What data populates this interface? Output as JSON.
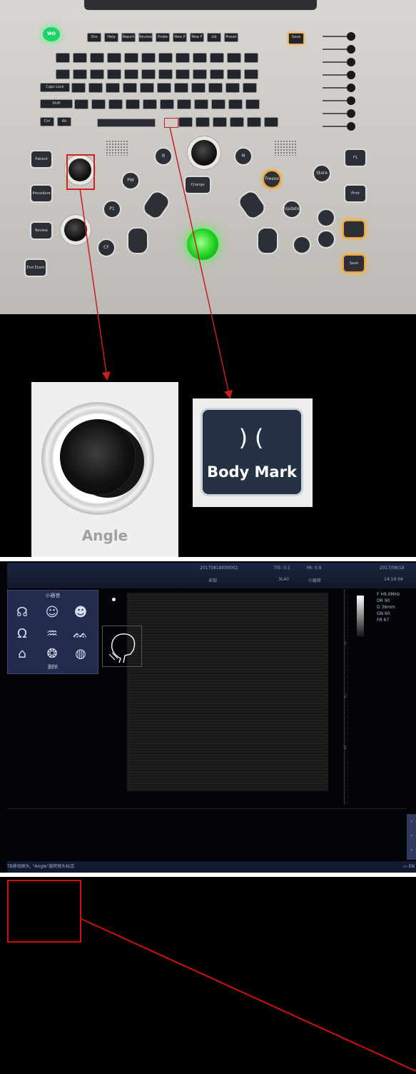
{
  "keyboard": {
    "power_label": "WO",
    "top_row": [
      "Sho",
      "Help",
      "Report",
      "Review",
      "Probe",
      "New P",
      "New F",
      "Lib",
      "Preset",
      "Save"
    ],
    "caps_lock": "Caps Lock",
    "shift": "Shift",
    "ctrl": "Ctrl",
    "alt": "Alt",
    "left_buttons": [
      "Patient",
      "Procedure",
      "Review",
      "End Exam"
    ],
    "right_buttons": [
      "F1",
      "Freeze",
      "Store",
      "Print",
      "Save"
    ],
    "center_buttons": [
      "Change",
      "B",
      "M",
      "PW",
      "CF",
      "P1",
      "Update"
    ],
    "accent_color": "#f2a22f",
    "trackball_color": "#2fe22f"
  },
  "callouts": {
    "angle_label": "Angle",
    "body_mark_icon": ")(",
    "body_mark_label": "Body Mark"
  },
  "ultrasound": {
    "header": {
      "patient_id": "20170818000002",
      "patient_name": "未知",
      "tis": "TIS: 0.1",
      "mi": "MI: 0.9",
      "probe": "3L40",
      "preset": "小器官",
      "date": "2017/08/18",
      "time": "14:16:04"
    },
    "bodymark_panel": {
      "title": "小器官",
      "icons": [
        "face-front-icon",
        "head-side-icon",
        "head-profile-icon",
        "neck-front-icon",
        "thyroid-icon",
        "breast-icon",
        "chest-icon",
        "breast-left-icon",
        "breast-right-icon"
      ],
      "glyphs": [
        "☊",
        "☺",
        "☻",
        "Ω",
        "♒",
        "ᨐ",
        "⌂",
        "❂",
        "◍"
      ],
      "footer": "删除"
    },
    "params": [
      "F  H9.0MHz",
      "DR  90",
      "D  36mm",
      "GN  60",
      "FR  67"
    ],
    "depth_ticks": [
      "1",
      "2",
      "3"
    ],
    "status_text": "TB移动探头, \"Angle\"旋转探头标志",
    "status_right": "▭ EN"
  }
}
